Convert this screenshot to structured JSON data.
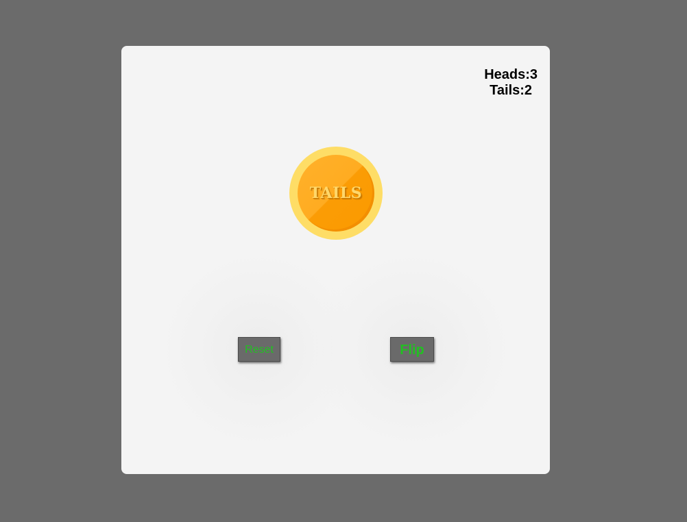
{
  "score": {
    "heads_label": "Heads:3",
    "tails_label": "Tails:2"
  },
  "coin": {
    "face": "TAILS",
    "colors": {
      "rim": "#fedd66",
      "face_light": "#ffb12b",
      "face_dark": "#fb9a00",
      "text": "#ffd76a"
    }
  },
  "buttons": {
    "reset_label": "Reset",
    "flip_label": "Flip"
  },
  "colors": {
    "background": "#6b6b6b",
    "card": "#f4f4f4",
    "button_bg": "#6a6a6a",
    "button_text": "#22c022"
  }
}
